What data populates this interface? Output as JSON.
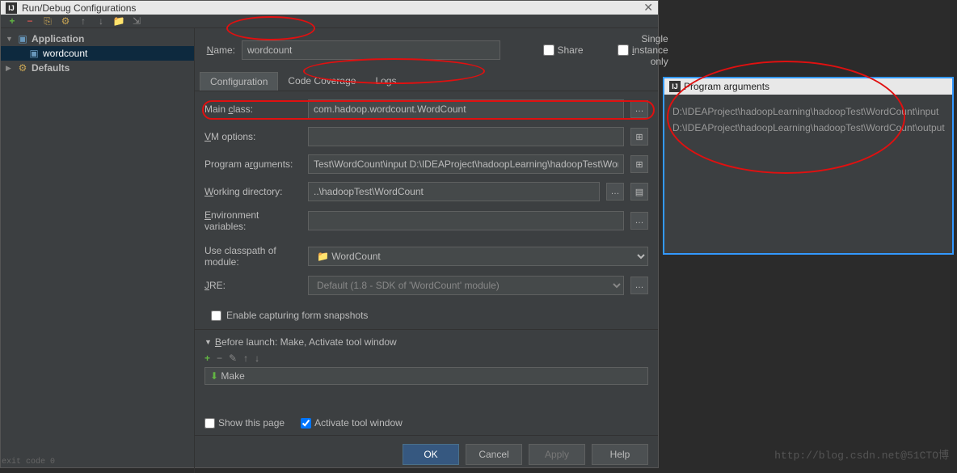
{
  "title": "Run/Debug Configurations",
  "sidebar": {
    "application": "Application",
    "wordcount": "wordcount",
    "defaults": "Defaults"
  },
  "header": {
    "name_label": "Name:",
    "name_value": "wordcount",
    "share": "Share",
    "single_instance": "Single instance only"
  },
  "tabs": [
    "Configuration",
    "Code Coverage",
    "Logs"
  ],
  "form": {
    "main_class_label": "Main class:",
    "main_class_value": "com.hadoop.wordcount.WordCount",
    "vm_options_label": "VM options:",
    "vm_options_value": "",
    "program_args_label": "Program arguments:",
    "program_args_value": "Test\\WordCount\\input D:\\IDEAProject\\hadoopLearning\\hadoopTest\\WordCount\\output",
    "working_dir_label": "Working directory:",
    "working_dir_value": "..\\hadoopTest\\WordCount",
    "env_label": "Environment variables:",
    "env_value": "",
    "classpath_label": "Use classpath of module:",
    "classpath_value": "WordCount",
    "jre_label": "JRE:",
    "jre_value": "Default (1.8 - SDK of 'WordCount' module)",
    "snapshots": "Enable capturing form snapshots"
  },
  "before": {
    "title": "Before launch: Make, Activate tool window",
    "make": "Make",
    "show_page": "Show this page",
    "activate": "Activate tool window"
  },
  "buttons": {
    "ok": "OK",
    "cancel": "Cancel",
    "apply": "Apply",
    "help": "Help"
  },
  "popup": {
    "title": "Program arguments",
    "line1": "D:\\IDEAProject\\hadoopLearning\\hadoopTest\\WordCount\\input",
    "line2": "D:\\IDEAProject\\hadoopLearning\\hadoopTest\\WordCount\\output"
  },
  "watermark": "http://blog.csdn.net@51CTO博",
  "exitcode": "exit code 0"
}
